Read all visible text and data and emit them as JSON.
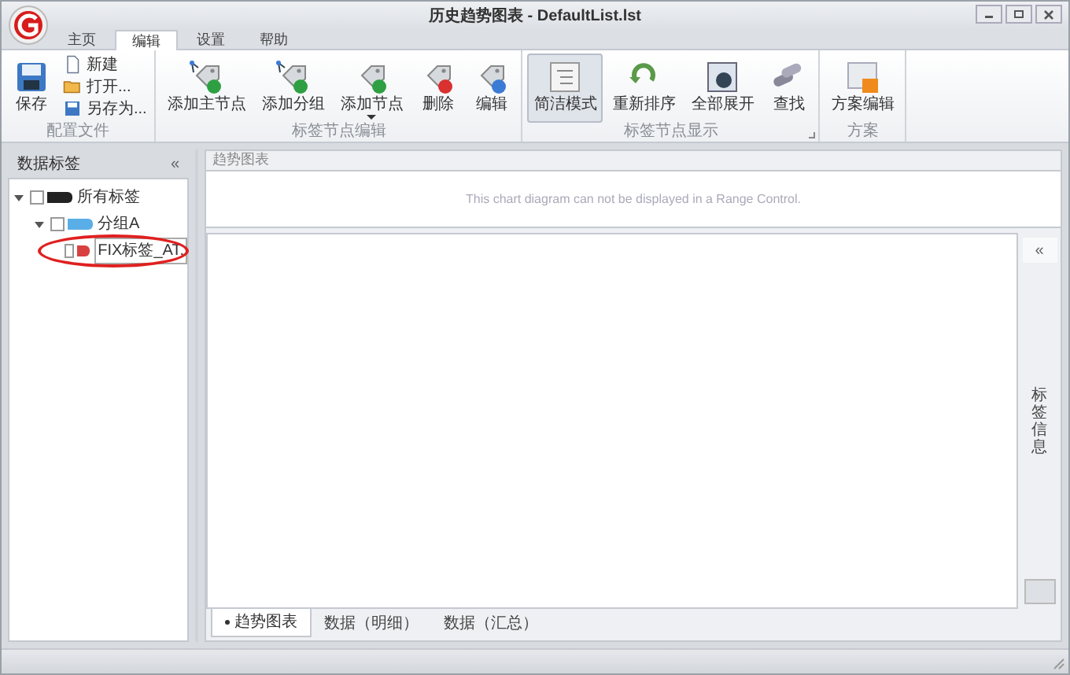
{
  "window": {
    "title": "历史趋势图表 - DefaultList.lst"
  },
  "ribbon_tabs": [
    {
      "label": "主页",
      "selected": false
    },
    {
      "label": "编辑",
      "selected": true
    },
    {
      "label": "设置",
      "selected": false
    },
    {
      "label": "帮助",
      "selected": false
    }
  ],
  "ribbon_groups": [
    {
      "label": "配置文件",
      "buttons": [
        {
          "label": "保存",
          "kind": "large",
          "selected": false,
          "dropdown": false
        },
        {
          "label": "新建",
          "kind": "small",
          "selected": false
        },
        {
          "label": "打开...",
          "kind": "small",
          "selected": false
        },
        {
          "label": "另存为...",
          "kind": "small",
          "selected": false
        }
      ]
    },
    {
      "label": "标签节点编辑",
      "buttons": [
        {
          "label": "添加主节点",
          "kind": "large",
          "selected": false,
          "dropdown": false
        },
        {
          "label": "添加分组",
          "kind": "large",
          "selected": false,
          "dropdown": false
        },
        {
          "label": "添加节点",
          "kind": "large",
          "selected": false,
          "dropdown": true
        },
        {
          "label": "删除",
          "kind": "large",
          "selected": false,
          "dropdown": false
        },
        {
          "label": "编辑",
          "kind": "large",
          "selected": false,
          "dropdown": false
        }
      ]
    },
    {
      "label": "标签节点显示",
      "launcher": true,
      "buttons": [
        {
          "label": "简洁模式",
          "kind": "large",
          "selected": true,
          "dropdown": false
        },
        {
          "label": "重新排序",
          "kind": "large",
          "selected": false,
          "dropdown": false
        },
        {
          "label": "全部展开",
          "kind": "large",
          "selected": false,
          "dropdown": false
        },
        {
          "label": "查找",
          "kind": "large",
          "selected": false,
          "dropdown": false
        }
      ]
    },
    {
      "label": "方案",
      "buttons": [
        {
          "label": "方案编辑",
          "kind": "large",
          "selected": false,
          "dropdown": false
        }
      ]
    }
  ],
  "left_panel": {
    "title": "数据标签",
    "collapse": "«",
    "tree": [
      {
        "label": "所有标签",
        "kind": "root",
        "expanded": true,
        "checked": false,
        "children": [
          {
            "label": "分组A",
            "kind": "group",
            "expanded": true,
            "checked": false,
            "children": [
              {
                "label": "FIX标签_AT.",
                "kind": "tag",
                "checked": false,
                "highlighted": true
              }
            ]
          }
        ]
      }
    ]
  },
  "chart_panel": {
    "title": "趋势图表",
    "range_message": "This chart diagram can not be displayed in a Range Control."
  },
  "bottom_tabs": [
    {
      "label": "趋势图表",
      "selected": true
    },
    {
      "label": "数据（明细）",
      "selected": false
    },
    {
      "label": "数据（汇总）",
      "selected": false
    }
  ],
  "right_panel": {
    "expand": "«",
    "title": "标签信息"
  }
}
